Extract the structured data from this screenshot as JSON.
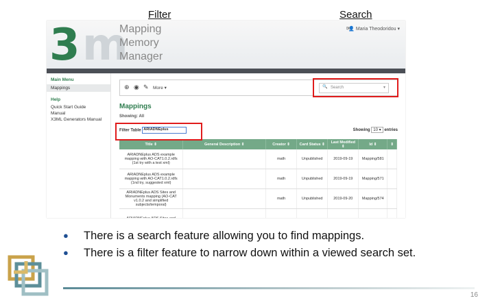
{
  "callouts": {
    "filter": "Filter",
    "search": "Search"
  },
  "app": {
    "logo_left": "3",
    "logo_right": "m",
    "title_lines": [
      "Mapping",
      "Memory",
      "Manager"
    ],
    "user_name": "Maria Theodoridou",
    "mail_icon": "envelope-icon"
  },
  "sidebar": {
    "main_menu_heading": "Main Menu",
    "main_items": [
      "Mappings"
    ],
    "help_heading": "Help",
    "help_items": [
      "Quick Start Guide",
      "Manual",
      "X3ML Generators Manual"
    ]
  },
  "main": {
    "more_label": "More",
    "search_placeholder": "Search",
    "title": "Mappings",
    "showing": "Showing: All",
    "filter_label": "Filter Table",
    "filter_value": "ARIADNEplus",
    "showing_label": "Showing",
    "entries_count": "10",
    "entries_label": "entries"
  },
  "table": {
    "headers": [
      "Title",
      "General Description",
      "Creator",
      "Card Status",
      "Last Modified",
      "Id"
    ],
    "rows": [
      [
        "ARIADNEplus ADS example mapping with AO-CAT1.0.2.rdfs (1st try with a test xml)",
        "",
        "math",
        "Unpublished",
        "2019-09-19",
        "Mapping/581"
      ],
      [
        "ARIADNEplus ADS example mapping with AO-CAT1.0.2.rdfs (1nd try, suggested xml)",
        "",
        "math",
        "Unpublished",
        "2019-09-19",
        "Mapping/571"
      ],
      [
        "ARIADNEplus ADS Sites and Monuments mapping (AO-CAT v1.0.2 and simplified subjects/temporal)",
        "",
        "math",
        "Unpublished",
        "2019-09-20",
        "Mapping/574"
      ],
      [
        "ARIADNEplus ADS Sites and",
        "",
        "",
        "",
        "",
        ""
      ]
    ]
  },
  "bullets": [
    "There is a search feature allowing you to find mappings.",
    "There is a filter feature to narrow down within a viewed search set."
  ],
  "page_number": "16",
  "colors": {
    "accent_green": "#2f7d4f",
    "table_header": "#74a988",
    "callout_red": "#e01b1b",
    "bullet_blue": "#1f4f93"
  }
}
